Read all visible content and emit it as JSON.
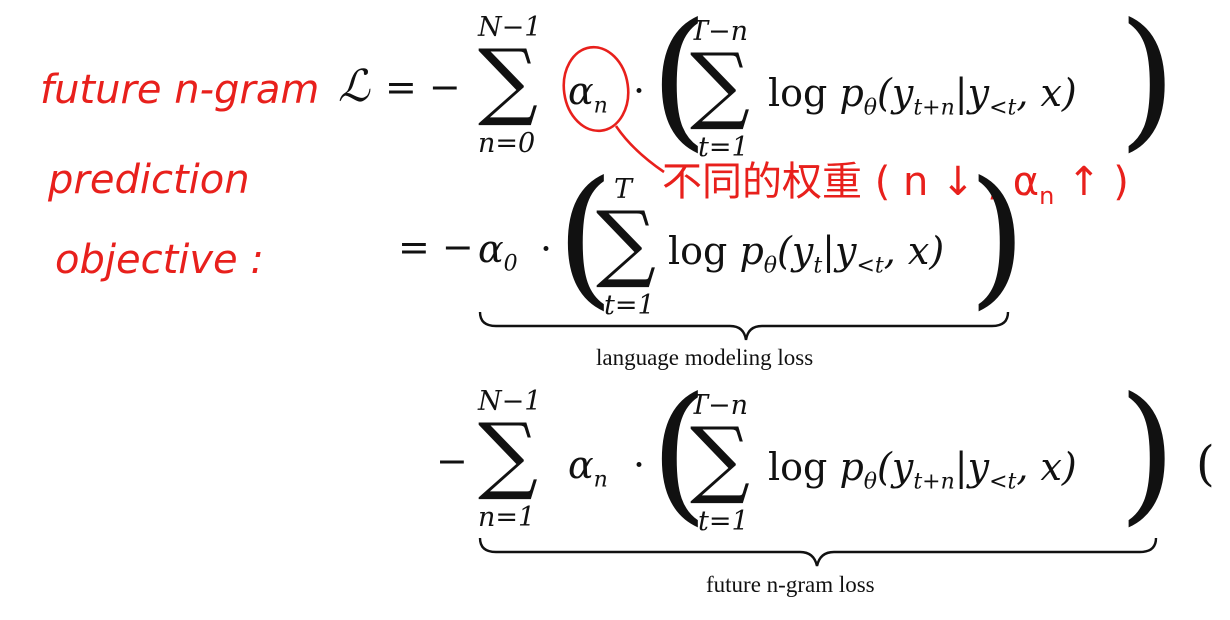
{
  "annotation": {
    "lines": [
      "future n-gram",
      "prediction",
      "objective :"
    ],
    "note": "不同的权重 ( n ↓ , α",
    "note_sub": "n",
    "note_end": "↑ )"
  },
  "formula": {
    "lhs": "ℒ",
    "eq": "= −",
    "eq2": "= −",
    "minus": "−",
    "sum_top": "N−1",
    "sum_bot_0": "n=0",
    "sum_bot_1": "n=1",
    "inner_top_1": "T−n",
    "inner_top_2": "T",
    "inner_bot": "t=1",
    "alpha": "α",
    "sub_n": "n",
    "sub_0": "0",
    "cdot": "·",
    "log": "log",
    "p": "p",
    "theta": "θ",
    "arg_1": "(y",
    "arg_1_sub": "t+n",
    "arg_2_sub": "t",
    "cond": "|y",
    "cond_sub": "<t",
    "tail": ", x)",
    "lm_loss": "language modeling loss",
    "ngram_loss": "future n-gram loss",
    "eqnum": "("
  }
}
